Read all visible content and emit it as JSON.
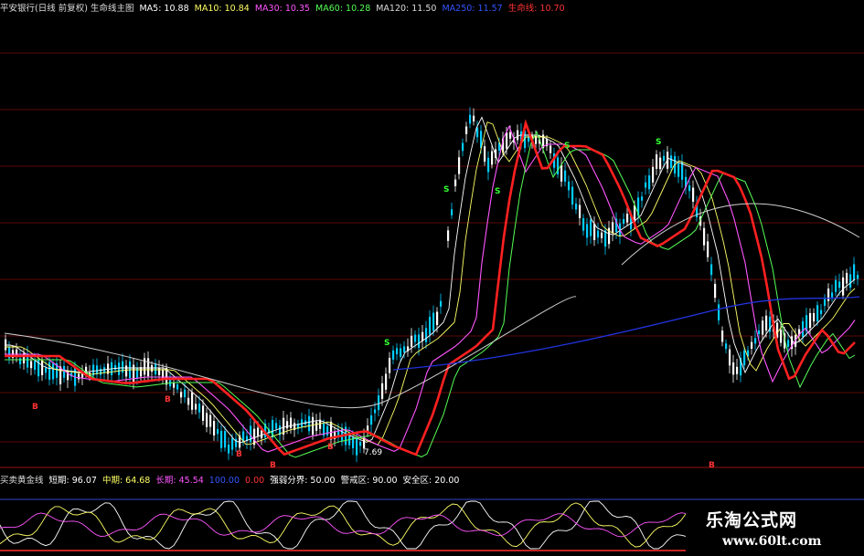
{
  "top_legend": {
    "items": [
      {
        "text": "平安银行(日线 前复权) 生命线主图",
        "color": "#dcdcdc"
      },
      {
        "text": "MA5: 10.88",
        "color": "#ffffff"
      },
      {
        "text": "MA10: 10.84",
        "color": "#ffff66"
      },
      {
        "text": "MA30: 10.35",
        "color": "#ff55ff"
      },
      {
        "text": "MA60: 10.28",
        "color": "#55ff55"
      },
      {
        "text": "MA120: 11.50",
        "color": "#dcdcdc"
      },
      {
        "text": "MA250: 11.57",
        "color": "#3355ff"
      },
      {
        "text": "生命线: 10.70",
        "color": "#ff3333"
      }
    ]
  },
  "bottom_legend": {
    "items": [
      {
        "text": "买卖黄金线",
        "color": "#dcdcdc"
      },
      {
        "text": "短期: 96.07",
        "color": "#ffffff"
      },
      {
        "text": "中期: 64.68",
        "color": "#ffff66"
      },
      {
        "text": "长期: 45.54",
        "color": "#ff55ff"
      },
      {
        "text": "100.00",
        "color": "#3355ff"
      },
      {
        "text": "0.00",
        "color": "#ff3333"
      },
      {
        "text": "强弱分界: 50.00",
        "color": "#ffffff"
      },
      {
        "text": "警戒区: 90.00",
        "color": "#ffffff"
      },
      {
        "text": "安全区: 20.00",
        "color": "#ffffff"
      }
    ]
  },
  "price_annotation": "7.69",
  "signal_marks": {
    "buy": "S",
    "sell": "B"
  },
  "watermark": {
    "title": "乐淘公式网",
    "url": "www.60lt.com"
  },
  "colors": {
    "background": "#000000",
    "grid": "#7a0a0a",
    "up_candle": "#ffffff",
    "down_candle": "#00ccff",
    "lifeline": "#ff2020",
    "ma250": "#2233dd"
  }
}
